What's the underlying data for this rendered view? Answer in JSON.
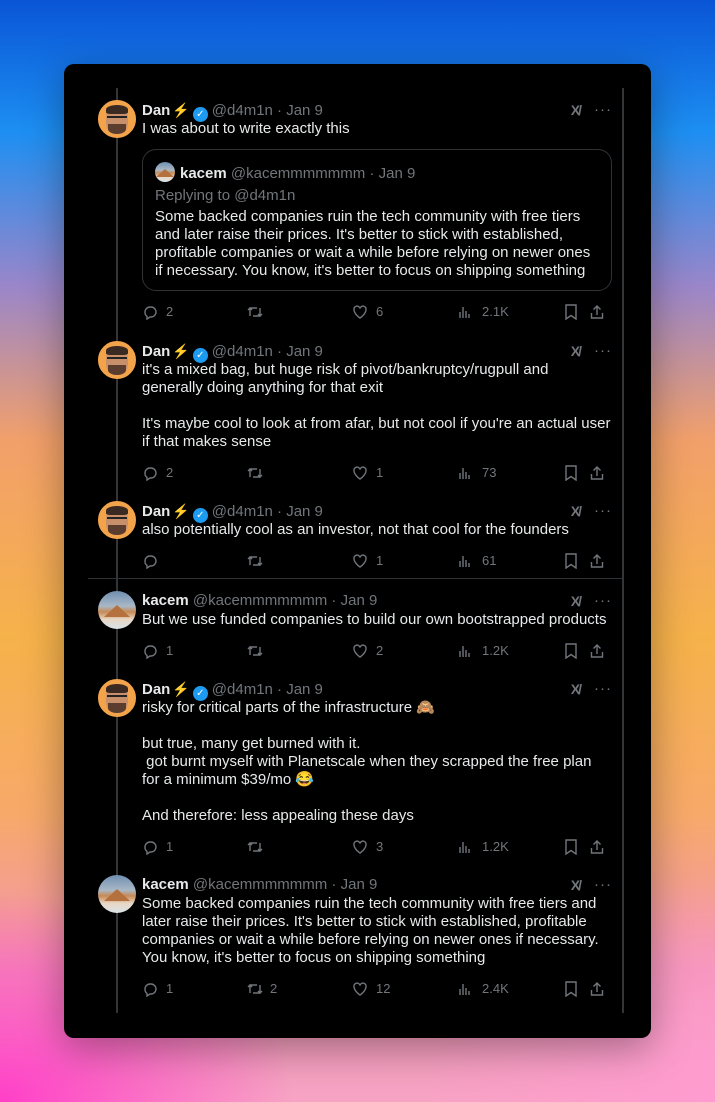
{
  "icons": {
    "reply": "reply-icon",
    "retweet": "retweet-icon",
    "like": "heart-icon",
    "views": "views-icon",
    "bookmark": "bookmark-icon",
    "share": "share-icon",
    "grok": "grok-icon",
    "more": "more-icon"
  },
  "colors": {
    "card_bg": "#000000",
    "text": "#e7e9ea",
    "muted": "#71767b",
    "verified": "#1d9bf0",
    "bolt": "#f6c33d"
  },
  "tweets": [
    {
      "name": "Dan",
      "bolt": "⚡",
      "handle": "@d4m1n · Jan 9",
      "text": "I was about to write exactly this",
      "quote": {
        "name": "kacem",
        "handle": "@kacemmmmmmm · Jan 9",
        "replying": "Replying to @d4m1n",
        "text": "Some backed companies ruin the tech community with free tiers and later raise their prices. It's better to stick with established, profitable companies or wait a while before relying on newer ones if necessary. You know, it's better to focus on shipping something"
      },
      "stats": {
        "replies": "2",
        "retweets": "",
        "likes": "6",
        "views": "2.1K"
      }
    },
    {
      "name": "Dan",
      "bolt": "⚡",
      "handle": "@d4m1n · Jan 9",
      "text": "it's a mixed bag, but huge risk of pivot/bankruptcy/rugpull and generally doing anything for that exit\n\nIt's maybe cool to look at from afar, but not cool if you're an actual user if that makes sense",
      "stats": {
        "replies": "2",
        "retweets": "",
        "likes": "1",
        "views": "73"
      }
    },
    {
      "name": "Dan",
      "bolt": "⚡",
      "handle": "@d4m1n · Jan 9",
      "text": "also potentially cool as an investor, not that cool for the founders",
      "stats": {
        "replies": "",
        "retweets": "",
        "likes": "1",
        "views": "61"
      }
    },
    {
      "name": "kacem",
      "handle": "@kacemmmmmmm · Jan 9",
      "text": "But we use funded companies to build our own bootstrapped products",
      "stats": {
        "replies": "1",
        "retweets": "",
        "likes": "2",
        "views": "1.2K"
      }
    },
    {
      "name": "Dan",
      "bolt": "⚡",
      "handle": "@d4m1n · Jan 9",
      "text": "risky for critical parts of the infrastructure 🙈\n\nbut true, many get burned with it.\n got burnt myself with Planetscale when they scrapped the free plan for a minimum $39/mo 😂\n\nAnd therefore: less appealing these days",
      "stats": {
        "replies": "1",
        "retweets": "",
        "likes": "3",
        "views": "1.2K"
      }
    },
    {
      "name": "kacem",
      "handle": "@kacemmmmmmm · Jan 9",
      "text": "Some backed companies ruin the tech community with free tiers and later raise their prices. It's better to stick with established, profitable companies or wait a while before relying on newer ones if necessary. You know, it's better to focus on shipping something",
      "stats": {
        "replies": "1",
        "retweets": "2",
        "likes": "12",
        "views": "2.4K"
      }
    }
  ]
}
